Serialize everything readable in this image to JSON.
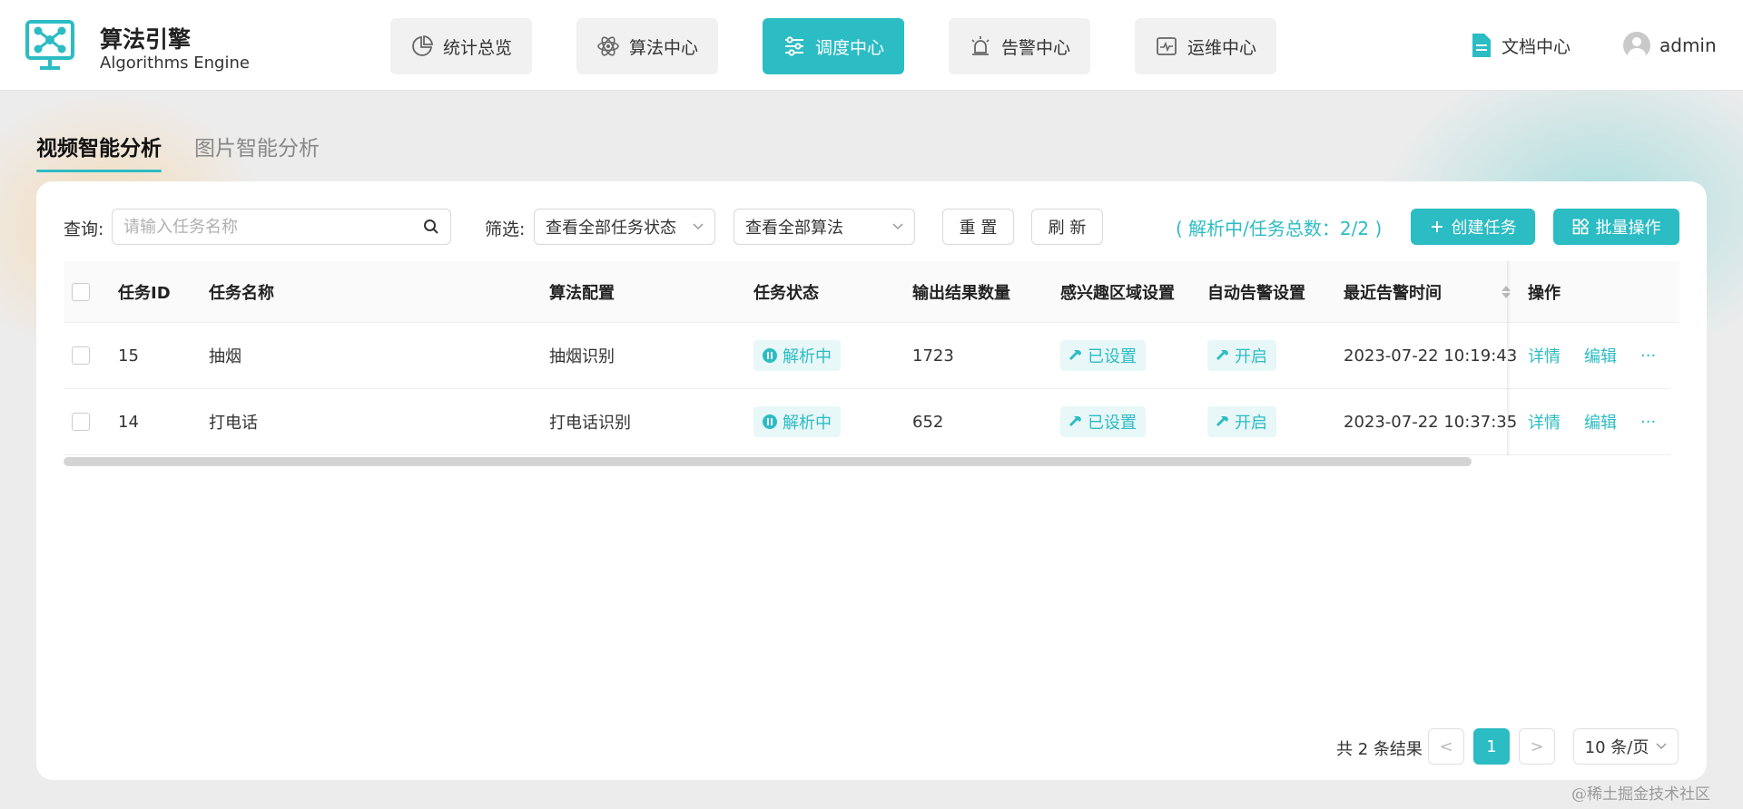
{
  "brand": {
    "title": "算法引擎",
    "subtitle": "Algorithms Engine"
  },
  "nav": [
    {
      "label": "统计总览",
      "icon": "pie-chart-icon",
      "active": false
    },
    {
      "label": "算法中心",
      "icon": "atom-icon",
      "active": false
    },
    {
      "label": "调度中心",
      "icon": "sliders-icon",
      "active": true
    },
    {
      "label": "告警中心",
      "icon": "alarm-icon",
      "active": false
    },
    {
      "label": "运维中心",
      "icon": "monitor-pulse-icon",
      "active": false
    }
  ],
  "header_right": {
    "docs_label": "文档中心",
    "user_name": "admin"
  },
  "page_tabs": [
    {
      "label": "视频智能分析",
      "active": true
    },
    {
      "label": "图片智能分析",
      "active": false
    }
  ],
  "toolbar": {
    "query_label": "查询:",
    "search_placeholder": "请输入任务名称",
    "filter_label": "筛选:",
    "status_select": "查看全部任务状态",
    "algo_select": "查看全部算法",
    "reset_label": "重 置",
    "refresh_label": "刷 新",
    "stat_text": "( 解析中/任务总数：2/2 )",
    "create_label": "创建任务",
    "batch_label": "批量操作"
  },
  "table": {
    "columns": [
      "任务ID",
      "任务名称",
      "算法配置",
      "任务状态",
      "输出结果数量",
      "感兴趣区域设置",
      "自动告警设置",
      "最近告警时间",
      "操作"
    ],
    "rows": [
      {
        "id": "15",
        "name": "抽烟",
        "algo": "抽烟识别",
        "status": "解析中",
        "count": "1723",
        "roi": "已设置",
        "alarm": "开启",
        "time": "2023-07-22 10:19:43",
        "op_detail": "详情",
        "op_edit": "编辑",
        "op_more": "···"
      },
      {
        "id": "14",
        "name": "打电话",
        "algo": "打电话识别",
        "status": "解析中",
        "count": "652",
        "roi": "已设置",
        "alarm": "开启",
        "time": "2023-07-22 10:37:35",
        "op_detail": "详情",
        "op_edit": "编辑",
        "op_more": "···"
      }
    ]
  },
  "pagination": {
    "total_text": "共 2 条结果",
    "prev": "<",
    "current_page": "1",
    "next": ">",
    "page_size": "10 条/页"
  },
  "watermark": "@稀土掘金技术社区",
  "colors": {
    "accent": "#2cbcc3",
    "tag_bg": "#e8f7f8"
  }
}
